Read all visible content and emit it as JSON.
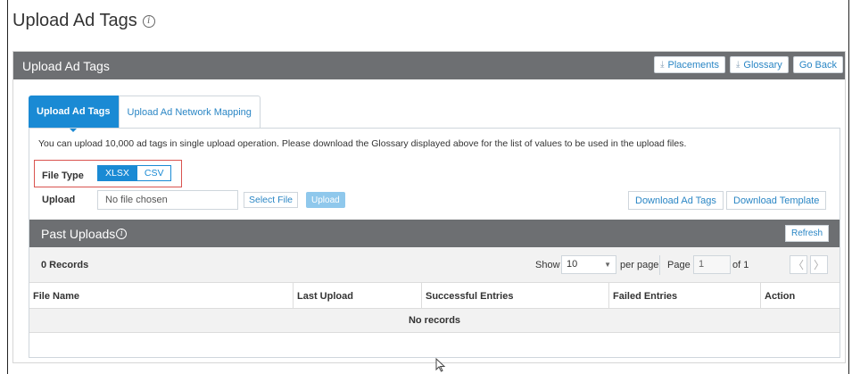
{
  "page": {
    "title": "Upload Ad Tags",
    "info_icon": "info-circle-icon"
  },
  "panel": {
    "title": "Upload Ad Tags",
    "buttons": {
      "placements": "Placements",
      "glossary": "Glossary",
      "go_back": "Go Back"
    }
  },
  "tabs": [
    {
      "label": "Upload Ad Tags",
      "active": true
    },
    {
      "label": "Upload Ad Network Mapping",
      "active": false
    }
  ],
  "description": "You can upload 10,000 ad tags in single upload operation. Please download the Glossary displayed above for the list of values to be used in the upload files.",
  "file_type": {
    "label": "File Type",
    "options": [
      "XLSX",
      "CSV"
    ],
    "selected": "XLSX"
  },
  "upload": {
    "label": "Upload",
    "file_placeholder": "No file chosen",
    "select_file": "Select File",
    "upload_button": "Upload",
    "download_ad_tags": "Download Ad Tags",
    "download_template": "Download Template"
  },
  "past_uploads": {
    "title": "Past Uploads",
    "refresh": "Refresh",
    "records": "0 Records",
    "show_label": "Show",
    "show_value": "10",
    "per_page": "per page",
    "page_label": "Page",
    "page_value": "1",
    "of_label": "of 1",
    "columns": [
      "File Name",
      "Last Upload",
      "Successful Entries",
      "Failed Entries",
      "Action"
    ],
    "empty_text": "No records"
  },
  "colors": {
    "accent": "#1a8ad4",
    "header_bg": "#6d6f72",
    "highlight_border": "#d9534f"
  }
}
